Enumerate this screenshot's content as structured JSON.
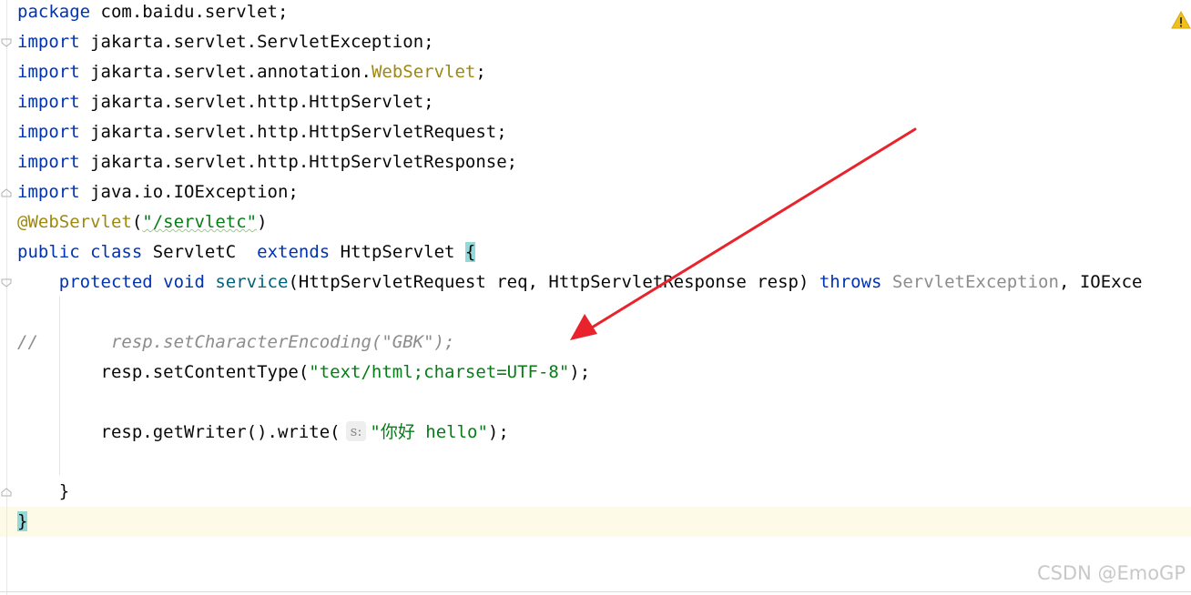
{
  "editor": {
    "lines": {
      "l1": {
        "k": "package",
        "t": " com.baidu.servlet;"
      },
      "l2": {
        "k": "import",
        "t": " jakarta.servlet.ServletException;"
      },
      "l3": {
        "k": "import",
        "t1": " jakarta.servlet.annotation.",
        "a": "WebServlet",
        "t2": ";"
      },
      "l4": {
        "k": "import",
        "t": " jakarta.servlet.http.HttpServlet;"
      },
      "l5": {
        "k": "import",
        "t": " jakarta.servlet.http.HttpServletRequest;"
      },
      "l6": {
        "k": "import",
        "t": " jakarta.servlet.http.HttpServletResponse;"
      },
      "l7": {
        "k": "import",
        "t": " java.io.IOException;"
      },
      "l8": {
        "a": "@WebServlet",
        "p1": "(",
        "s": "\"/servletc\"",
        "p2": ")"
      },
      "l9": {
        "k1": "public",
        "k2": " class",
        "t1": " ServletC  ",
        "k3": "extends",
        "t2": " HttpServlet ",
        "b": "{"
      },
      "l10": {
        "k1": "protected",
        "k2": " void",
        "m": " service",
        "t1": "(HttpServletRequest req, HttpServletResponse resp) ",
        "k3": "throws",
        "g": " ServletException",
        "t2": ", IOExce"
      },
      "l11": {
        "c": "//       resp.setCharacterEncoding(\"GBK\");"
      },
      "l12": {
        "t1": "resp.setContentType(",
        "s": "\"text/html;charset=UTF-8\"",
        "t2": ");"
      },
      "l13": {
        "t1": "resp.getWriter().write(",
        "hint": "s:",
        "s": "\"你好 hello\"",
        "t2": ");"
      },
      "l14": {
        "t": "}"
      },
      "l15": {
        "b": "}"
      }
    }
  },
  "icons": {
    "warning": "warning-triangle-icon",
    "arrow": "red-arrow-annotation"
  },
  "colors": {
    "keyword": "#0033b3",
    "string": "#067d17",
    "annotation": "#9e880d",
    "comment": "#8c8c8c",
    "arrow": "#e8232b",
    "warning": "#f2c01e"
  },
  "watermark": "CSDN @EmoGP"
}
